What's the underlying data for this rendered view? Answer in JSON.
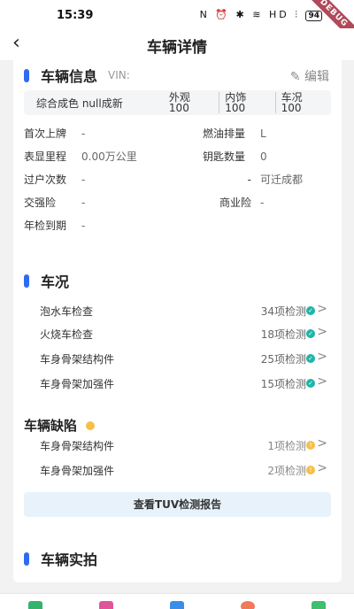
{
  "status": {
    "time": "15:39",
    "icons_text": "N ⏰ ✱ ≋ HD ⫶",
    "battery": "94",
    "debug": "DEBUG"
  },
  "appbar": {
    "back": "‹",
    "title": "车辆详情"
  },
  "vehicle_info": {
    "title": "车辆信息",
    "vin_label": "VIN:",
    "edit_label": "✎ 编辑",
    "summary": {
      "color": "综合成色 null成新",
      "items": [
        "外观 100",
        "内饰 100",
        "车况 100"
      ]
    },
    "fields": [
      {
        "label": "首次上牌",
        "value": "-"
      },
      {
        "label": "燃油排量",
        "value": "L"
      },
      {
        "label": "表显里程",
        "value": "0.00万公里"
      },
      {
        "label": "钥匙数量",
        "value": "0"
      },
      {
        "label": "过户次数",
        "value": "-"
      },
      {
        "label": "-",
        "value": "可迁成都"
      },
      {
        "label": "交强险",
        "value": "-"
      },
      {
        "label": "商业险",
        "value": "-"
      },
      {
        "label": "年检到期",
        "value": "-"
      }
    ]
  },
  "condition": {
    "title": "车况",
    "checks": [
      {
        "name": "泡水车检查",
        "count": "34项检测"
      },
      {
        "name": "火烧车检查",
        "count": "18项检测"
      },
      {
        "name": "车身骨架结构件",
        "count": "25项检测"
      },
      {
        "name": "车身骨架加强件",
        "count": "15项检测"
      }
    ],
    "defects_title": "车辆缺陷",
    "defects": [
      {
        "name": "车身骨架结构件",
        "count": "1项检测"
      },
      {
        "name": "车身骨架加强件",
        "count": "2项检测"
      }
    ],
    "tuv_button": "查看TUV检测报告"
  },
  "photos": {
    "title": "车辆实拍"
  },
  "colors": {
    "accent": "#2f6bf0",
    "ok": "#1fb5a6",
    "warn": "#f5c04a"
  },
  "icons": {
    "back": "chevron-left-icon",
    "edit": "edit-icon",
    "ok": "check-icon",
    "warn": "warning-icon",
    "more": "chevron-right-icon"
  }
}
